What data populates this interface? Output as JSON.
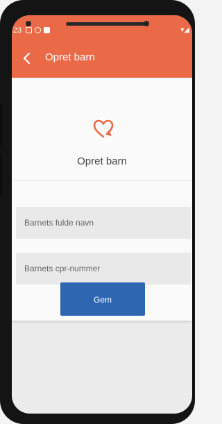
{
  "status_bar": {
    "time": "23",
    "right_icons": "▾◢"
  },
  "app_bar": {
    "title": "Opret barn",
    "back_icon": "chevron-left-icon"
  },
  "card": {
    "logo_icon": "heart-icon",
    "heading": "Opret barn",
    "fields": [
      {
        "placeholder": "Barnets fulde navn"
      },
      {
        "placeholder": "Barnets cpr-nummer"
      }
    ],
    "save_label": "Gem"
  },
  "colors": {
    "accent": "#ea6a48",
    "button": "#2f66b1"
  }
}
